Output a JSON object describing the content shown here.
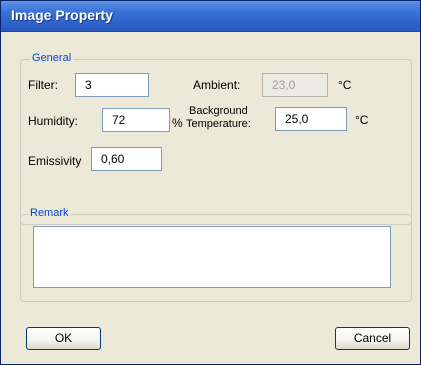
{
  "window": {
    "title": "Image Property"
  },
  "general": {
    "legend": "General",
    "filter": {
      "label": "Filter:",
      "value": "3"
    },
    "ambient": {
      "label": "Ambient:",
      "value": "23,0",
      "unit": "°C",
      "disabled": true
    },
    "humidity": {
      "label": "Humidity:",
      "value": "72",
      "unit": "%"
    },
    "background_temperature": {
      "label_line1": "Background",
      "label_line2": "Temperature:",
      "value": "25,0",
      "unit": "°C"
    },
    "emissivity": {
      "label": "Emissivity",
      "value": "0,60"
    }
  },
  "remark": {
    "legend": "Remark",
    "value": ""
  },
  "buttons": {
    "ok": "OK",
    "cancel": "Cancel"
  }
}
